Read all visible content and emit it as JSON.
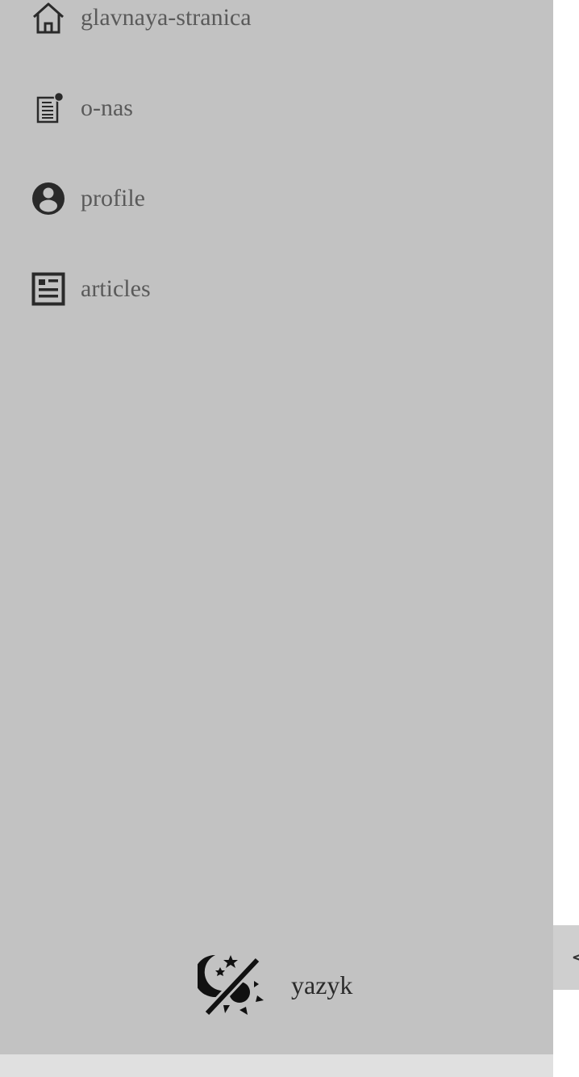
{
  "sidebar": {
    "items": [
      {
        "label": "glavnaya-stranica",
        "icon": "home-icon"
      },
      {
        "label": "o-nas",
        "icon": "document-notification-icon"
      },
      {
        "label": "profile",
        "icon": "account-circle-icon"
      },
      {
        "label": "articles",
        "icon": "newspaper-icon"
      }
    ],
    "background": "#c2c2c2",
    "text_color": "#5a5a5a"
  },
  "bottom": {
    "theme_icon": "theme-toggle-icon",
    "language_label": "yazyk"
  },
  "collapse_tab": {
    "glyph": "<"
  }
}
